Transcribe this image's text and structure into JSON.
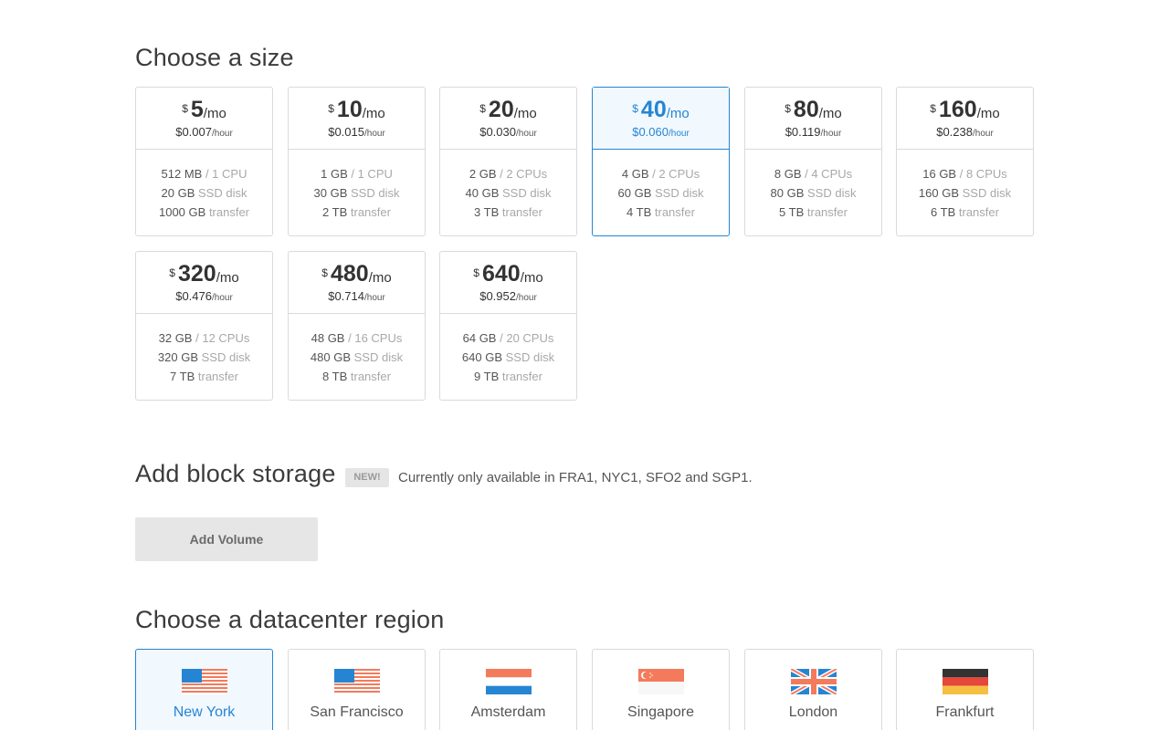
{
  "size_section": {
    "title": "Choose a size"
  },
  "sizes": [
    {
      "currency": "$",
      "amount": "5",
      "per_month": "/mo",
      "hourly": "$0.007",
      "per_hour": "/hour",
      "ram": "512 MB",
      "cpu": "/ 1 CPU",
      "disk": "20 GB",
      "disk_label": "SSD disk",
      "transfer": "1000 GB",
      "transfer_label": "transfer",
      "selected": false
    },
    {
      "currency": "$",
      "amount": "10",
      "per_month": "/mo",
      "hourly": "$0.015",
      "per_hour": "/hour",
      "ram": "1 GB",
      "cpu": "/ 1 CPU",
      "disk": "30 GB",
      "disk_label": "SSD disk",
      "transfer": "2 TB",
      "transfer_label": "transfer",
      "selected": false
    },
    {
      "currency": "$",
      "amount": "20",
      "per_month": "/mo",
      "hourly": "$0.030",
      "per_hour": "/hour",
      "ram": "2 GB",
      "cpu": "/ 2 CPUs",
      "disk": "40 GB",
      "disk_label": "SSD disk",
      "transfer": "3 TB",
      "transfer_label": "transfer",
      "selected": false
    },
    {
      "currency": "$",
      "amount": "40",
      "per_month": "/mo",
      "hourly": "$0.060",
      "per_hour": "/hour",
      "ram": "4 GB",
      "cpu": "/ 2 CPUs",
      "disk": "60 GB",
      "disk_label": "SSD disk",
      "transfer": "4 TB",
      "transfer_label": "transfer",
      "selected": true
    },
    {
      "currency": "$",
      "amount": "80",
      "per_month": "/mo",
      "hourly": "$0.119",
      "per_hour": "/hour",
      "ram": "8 GB",
      "cpu": "/ 4 CPUs",
      "disk": "80 GB",
      "disk_label": "SSD disk",
      "transfer": "5 TB",
      "transfer_label": "transfer",
      "selected": false
    },
    {
      "currency": "$",
      "amount": "160",
      "per_month": "/mo",
      "hourly": "$0.238",
      "per_hour": "/hour",
      "ram": "16 GB",
      "cpu": "/ 8 CPUs",
      "disk": "160 GB",
      "disk_label": "SSD disk",
      "transfer": "6 TB",
      "transfer_label": "transfer",
      "selected": false
    },
    {
      "currency": "$",
      "amount": "320",
      "per_month": "/mo",
      "hourly": "$0.476",
      "per_hour": "/hour",
      "ram": "32 GB",
      "cpu": "/ 12 CPUs",
      "disk": "320 GB",
      "disk_label": "SSD disk",
      "transfer": "7 TB",
      "transfer_label": "transfer",
      "selected": false
    },
    {
      "currency": "$",
      "amount": "480",
      "per_month": "/mo",
      "hourly": "$0.714",
      "per_hour": "/hour",
      "ram": "48 GB",
      "cpu": "/ 16 CPUs",
      "disk": "480 GB",
      "disk_label": "SSD disk",
      "transfer": "8 TB",
      "transfer_label": "transfer",
      "selected": false
    },
    {
      "currency": "$",
      "amount": "640",
      "per_month": "/mo",
      "hourly": "$0.952",
      "per_hour": "/hour",
      "ram": "64 GB",
      "cpu": "/ 20 CPUs",
      "disk": "640 GB",
      "disk_label": "SSD disk",
      "transfer": "9 TB",
      "transfer_label": "transfer",
      "selected": false
    }
  ],
  "storage_section": {
    "title": "Add block storage",
    "badge": "NEW!",
    "note": "Currently only available in FRA1, NYC1, SFO2 and SGP1.",
    "button_label": "Add Volume"
  },
  "region_section": {
    "title": "Choose a datacenter region"
  },
  "regions": [
    {
      "name": "New York",
      "flag": "us-flag-icon",
      "selected": true
    },
    {
      "name": "San Francisco",
      "flag": "us-flag-icon",
      "selected": false
    },
    {
      "name": "Amsterdam",
      "flag": "nl-flag-icon",
      "selected": false
    },
    {
      "name": "Singapore",
      "flag": "sg-flag-icon",
      "selected": false
    },
    {
      "name": "London",
      "flag": "uk-flag-icon",
      "selected": false
    },
    {
      "name": "Frankfurt",
      "flag": "de-flag-icon",
      "selected": false
    }
  ],
  "colors": {
    "accent": "#2585d3",
    "border": "#dadada",
    "selected_bg": "#f1f8fe",
    "muted_text": "#a8a8a8"
  }
}
